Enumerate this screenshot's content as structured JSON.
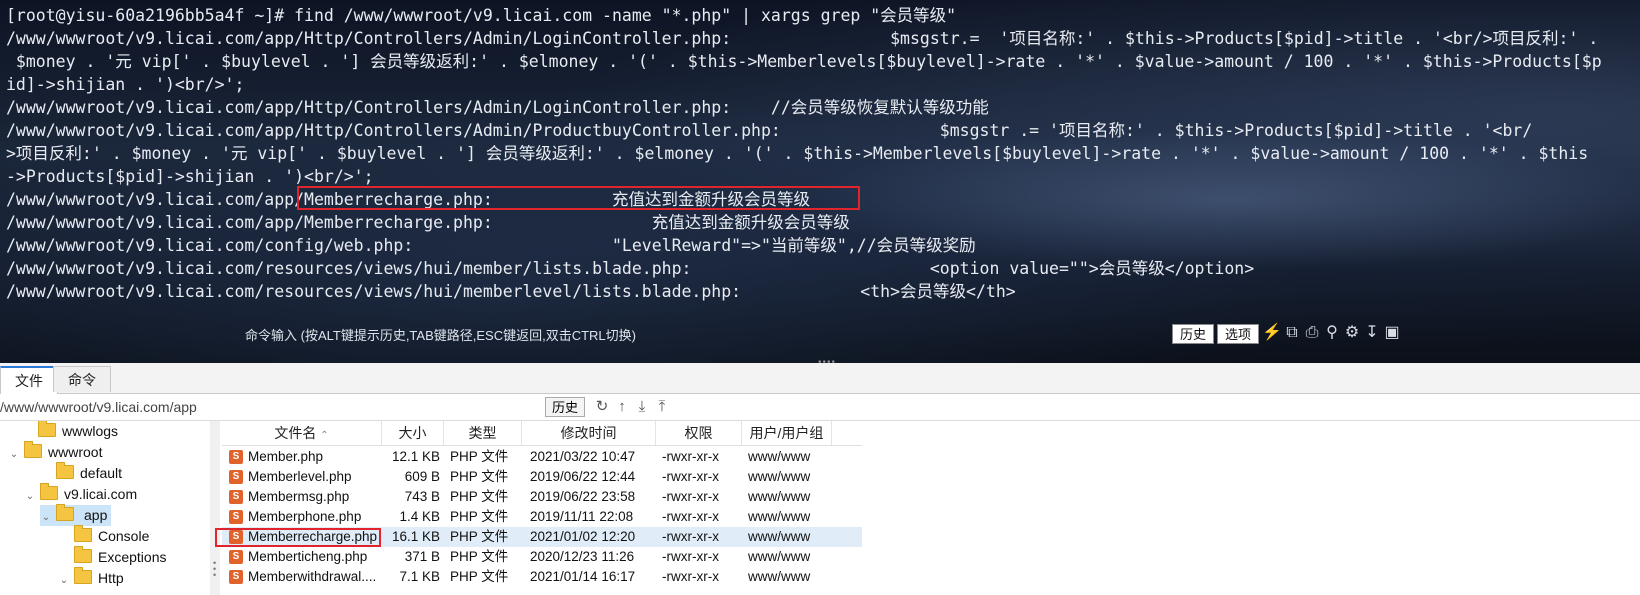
{
  "terminal": {
    "lines": [
      "[root@yisu-60a2196bb5a4f ~]# find /www/wwwroot/v9.licai.com -name \"*.php\" | xargs grep \"会员等级\"",
      "/www/wwwroot/v9.licai.com/app/Http/Controllers/Admin/LoginController.php:                $msgstr.=  '项目名称:' . $this->Products[$pid]->title . '<br/>项目反利:' .",
      " $money . '元 vip[' . $buylevel . '] 会员等级返利:' . $elmoney . '(' . $this->Memberlevels[$buylevel]->rate . '*' . $value->amount / 100 . '*' . $this->Products[$p",
      "id]->shijian . ')<br/>';",
      "/www/wwwroot/v9.licai.com/app/Http/Controllers/Admin/LoginController.php:    //会员等级恢复默认等级功能",
      "/www/wwwroot/v9.licai.com/app/Http/Controllers/Admin/ProductbuyController.php:                $msgstr .= '项目名称:' . $this->Products[$pid]->title . '<br/",
      ">项目反利:' . $money . '元 vip[' . $buylevel . '] 会员等级返利:' . $elmoney . '(' . $this->Memberlevels[$buylevel]->rate . '*' . $value->amount / 100 . '*' . $this",
      "->Products[$pid]->shijian . ')<br/>';",
      "/www/wwwroot/v9.licai.com/app/Memberrecharge.php:            充值达到金额升级会员等级",
      "/www/wwwroot/v9.licai.com/app/Memberrecharge.php:                充值达到金额升级会员等级",
      "/www/wwwroot/v9.licai.com/config/web.php:                    \"LevelReward\"=>\"当前等级\",//会员等级奖励",
      "/www/wwwroot/v9.licai.com/resources/views/hui/member/lists.blade.php:                        <option value=\"\">会员等级</option>",
      "/www/wwwroot/v9.licai.com/resources/views/hui/memberlevel/lists.blade.php:            <th>会员等级</th>"
    ],
    "command_hint": "命令输入 (按ALT键提示历史,TAB键路径,ESC键返回,双击CTRL切换)",
    "history_button": "历史",
    "options_button": "选项"
  },
  "tabs": [
    {
      "label": "文件",
      "active": true
    },
    {
      "label": "命令",
      "active": false
    }
  ],
  "pathbar": {
    "path": "/www/wwwroot/v9.licai.com/app",
    "history_button": "历史"
  },
  "tree": {
    "items": [
      {
        "label": "wwwlogs",
        "level": 1,
        "expanded": false,
        "selected": false
      },
      {
        "label": "wwwroot",
        "level": 0,
        "expanded": true,
        "selected": false
      },
      {
        "label": "default",
        "level": 2,
        "expanded": false,
        "selected": false
      },
      {
        "label": "v9.licai.com",
        "level": 1,
        "expanded": true,
        "selected": false
      },
      {
        "label": "app",
        "level": 2,
        "expanded": true,
        "selected": true
      },
      {
        "label": "Console",
        "level": 3,
        "expanded": false,
        "selected": false
      },
      {
        "label": "Exceptions",
        "level": 3,
        "expanded": false,
        "selected": false
      },
      {
        "label": "Http",
        "level": 3,
        "expanded": true,
        "selected": false
      }
    ]
  },
  "filelist": {
    "headers": [
      "文件名",
      "大小",
      "类型",
      "修改时间",
      "权限",
      "用户/用户组"
    ],
    "rows": [
      {
        "name": "Member.php",
        "size": "12.1 KB",
        "type": "PHP 文件",
        "mtime": "2021/03/22 10:47",
        "perm": "-rwxr-xr-x",
        "owner": "www/www",
        "selected": false
      },
      {
        "name": "Memberlevel.php",
        "size": "609 B",
        "type": "PHP 文件",
        "mtime": "2019/06/22 12:44",
        "perm": "-rwxr-xr-x",
        "owner": "www/www",
        "selected": false
      },
      {
        "name": "Membermsg.php",
        "size": "743 B",
        "type": "PHP 文件",
        "mtime": "2019/06/22 23:58",
        "perm": "-rwxr-xr-x",
        "owner": "www/www",
        "selected": false
      },
      {
        "name": "Memberphone.php",
        "size": "1.4 KB",
        "type": "PHP 文件",
        "mtime": "2019/11/11 22:08",
        "perm": "-rwxr-xr-x",
        "owner": "www/www",
        "selected": false
      },
      {
        "name": "Memberrecharge.php",
        "size": "16.1 KB",
        "type": "PHP 文件",
        "mtime": "2021/01/02 12:20",
        "perm": "-rwxr-xr-x",
        "owner": "www/www",
        "selected": true
      },
      {
        "name": "Memberticheng.php",
        "size": "371 B",
        "type": "PHP 文件",
        "mtime": "2020/12/23 11:26",
        "perm": "-rwxr-xr-x",
        "owner": "www/www",
        "selected": false
      },
      {
        "name": "Memberwithdrawal....",
        "size": "7.1 KB",
        "type": "PHP 文件",
        "mtime": "2021/01/14 16:17",
        "perm": "-rwxr-xr-x",
        "owner": "www/www",
        "selected": false
      }
    ]
  },
  "colors": {
    "highlight_border": "#e0262c",
    "selection": "#cce4f7",
    "tab_accent": "#2d79d6"
  }
}
